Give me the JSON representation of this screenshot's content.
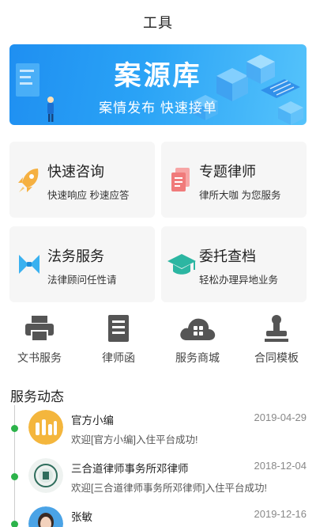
{
  "header": {
    "title": "工具"
  },
  "banner": {
    "title": "案源库",
    "subtitle": "案情发布  快速接单"
  },
  "cards": [
    {
      "title": "快速咨询",
      "desc": "快速响应 秒速应答",
      "icon": "rocket-icon",
      "color": "#f5b041"
    },
    {
      "title": "专题律师",
      "desc": "律所大咖 为您服务",
      "icon": "document-icon",
      "color": "#f07b7b"
    },
    {
      "title": "法务服务",
      "desc": "法律顾问任性请",
      "icon": "bowtie-icon",
      "color": "#3ab1f0"
    },
    {
      "title": "委托查档",
      "desc": "轻松办理异地业务",
      "icon": "graduation-cap-icon",
      "color": "#2cb6a2"
    }
  ],
  "tools": [
    {
      "label": "文书服务",
      "icon": "printer-icon"
    },
    {
      "label": "律师函",
      "icon": "letter-document-icon"
    },
    {
      "label": "服务商城",
      "icon": "cloud-store-icon"
    },
    {
      "label": "合同模板",
      "icon": "stamp-icon"
    }
  ],
  "feed": {
    "title": "服务动态",
    "items": [
      {
        "name": "官方小编",
        "date": "2019-04-29",
        "message": "欢迎[官方小编]入住平台成功!"
      },
      {
        "name": "三合道律师事务所邓律师",
        "date": "2018-12-04",
        "message": "欢迎[三合道律师事务所邓律师]入住平台成功!"
      },
      {
        "name": "张敏",
        "date": "2019-12-16",
        "message": ""
      }
    ]
  }
}
